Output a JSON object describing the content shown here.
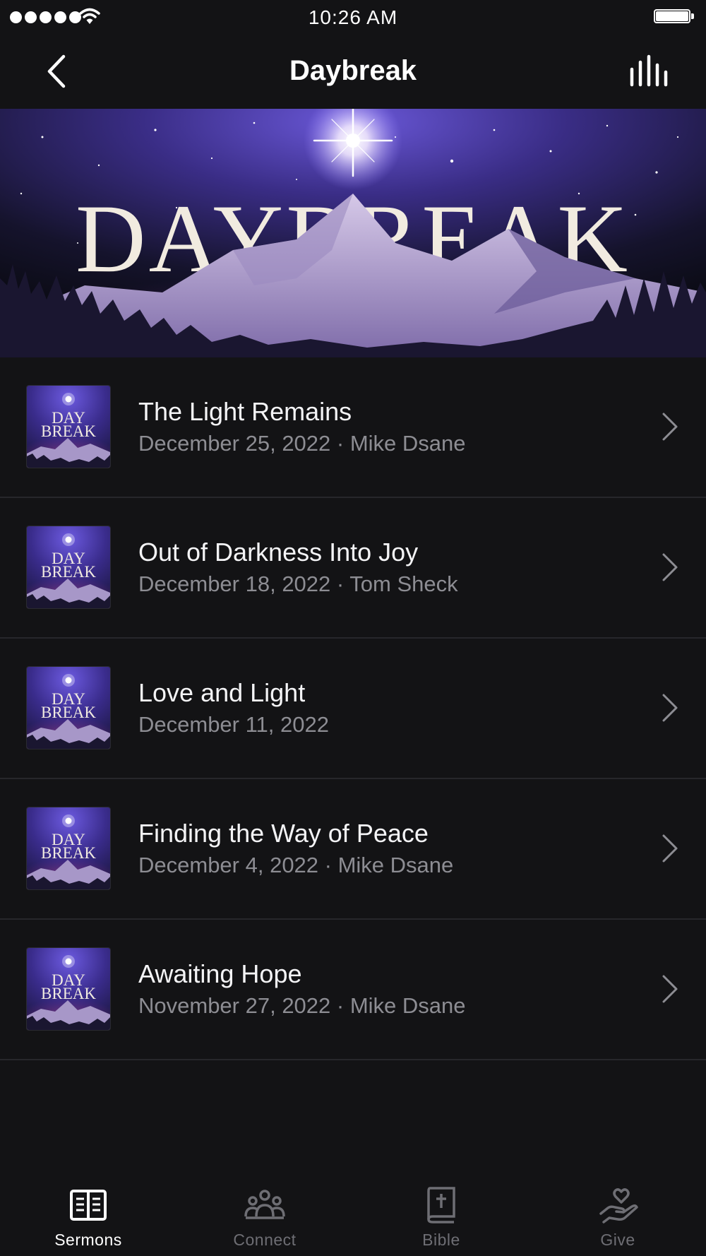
{
  "status_bar": {
    "time": "10:26 AM"
  },
  "nav": {
    "title": "Daybreak",
    "back_icon": "chevron-left-icon",
    "right_icon": "equalizer-levels-icon"
  },
  "hero": {
    "artwork_text": "DAYBREAK"
  },
  "thumbnail": {
    "line1": "DAY",
    "line2": "BREAK"
  },
  "sermons": [
    {
      "title": "The Light Remains",
      "subtitle": "December 25, 2022 · Mike Dsane"
    },
    {
      "title": "Out of Darkness Into Joy",
      "subtitle": "December 18, 2022 · Tom Sheck"
    },
    {
      "title": "Love and Light",
      "subtitle": "December 11, 2022"
    },
    {
      "title": "Finding the Way of Peace",
      "subtitle": "December 4, 2022 · Mike Dsane"
    },
    {
      "title": "Awaiting Hope",
      "subtitle": "November 27, 2022 · Mike Dsane"
    }
  ],
  "tabs": [
    {
      "label": "Sermons",
      "icon": "open-book-icon",
      "active": true
    },
    {
      "label": "Connect",
      "icon": "people-group-icon",
      "active": false
    },
    {
      "label": "Bible",
      "icon": "bible-icon",
      "active": false
    },
    {
      "label": "Give",
      "icon": "heart-hand-icon",
      "active": false
    }
  ],
  "colors": {
    "background": "#131315",
    "divider": "#27272b",
    "subtitle_gray": "#8d8d93",
    "inactive_tab": "#6e6e74",
    "hero_purple": "#4b3aa0",
    "hero_pink": "#e2508a"
  }
}
